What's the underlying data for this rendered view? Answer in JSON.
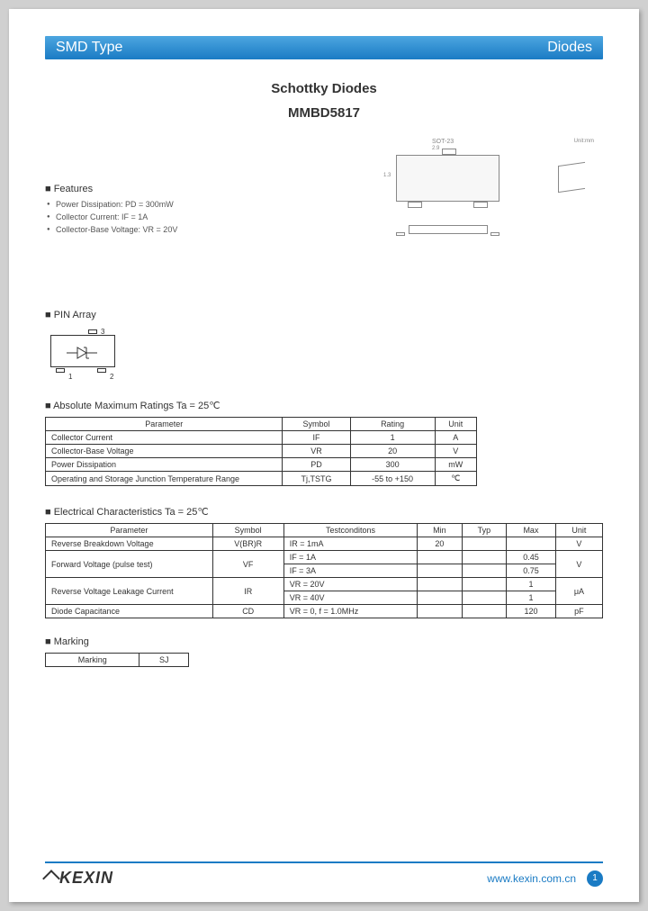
{
  "header": {
    "left": "SMD Type",
    "right": "Diodes"
  },
  "title": {
    "line1": "Schottky Diodes",
    "line2": "MMBD5817"
  },
  "features": {
    "heading": "Features",
    "items": [
      "Power Dissipation: PD = 300mW",
      "Collector Current: IF = 1A",
      "Collector-Base Voltage: VR = 20V"
    ]
  },
  "package": {
    "label": "SOT-23",
    "unit": "Unit:mm"
  },
  "pin_array": {
    "heading": "PIN Array",
    "pins": [
      "1",
      "2",
      "3"
    ]
  },
  "abs_max": {
    "heading": "Absolute Maximum Ratings Ta = 25℃",
    "cols": [
      "Parameter",
      "Symbol",
      "Rating",
      "Unit"
    ],
    "rows": [
      [
        "Collector Current",
        "IF",
        "1",
        "A"
      ],
      [
        "Collector-Base Voltage",
        "VR",
        "20",
        "V"
      ],
      [
        "Power Dissipation",
        "PD",
        "300",
        "mW"
      ],
      [
        "Operating and Storage Junction Temperature Range",
        "Tj,TSTG",
        "-55 to +150",
        "℃"
      ]
    ]
  },
  "elec": {
    "heading": "Electrical Characteristics Ta = 25℃",
    "cols": [
      "Parameter",
      "Symbol",
      "Testconditons",
      "Min",
      "Typ",
      "Max",
      "Unit"
    ],
    "rows": [
      {
        "param": "Reverse Breakdown Voltage",
        "symbol": "V(BR)R",
        "cond": "IR = 1mA",
        "min": "20",
        "typ": "",
        "max": "",
        "unit": "V",
        "rowspan": 1
      },
      {
        "param": "Forward Voltage (pulse test)",
        "symbol": "VF",
        "cond": "IF = 1A",
        "min": "",
        "typ": "",
        "max": "0.45",
        "unit": "V",
        "rowspan": 2
      },
      {
        "cond": "IF = 3A",
        "min": "",
        "typ": "",
        "max": "0.75"
      },
      {
        "param": "Reverse Voltage Leakage Current",
        "symbol": "IR",
        "cond": "VR = 20V",
        "min": "",
        "typ": "",
        "max": "1",
        "unit": "μA",
        "rowspan": 2
      },
      {
        "cond": "VR = 40V",
        "min": "",
        "typ": "",
        "max": "1"
      },
      {
        "param": "Diode Capacitance",
        "symbol": "CD",
        "cond": "VR = 0, f = 1.0MHz",
        "min": "",
        "typ": "",
        "max": "120",
        "unit": "pF",
        "rowspan": 1
      }
    ]
  },
  "marking": {
    "heading": "Marking",
    "label": "Marking",
    "value": "SJ"
  },
  "footer": {
    "brand": "KEXIN",
    "url": "www.kexin.com.cn",
    "page": "1"
  }
}
